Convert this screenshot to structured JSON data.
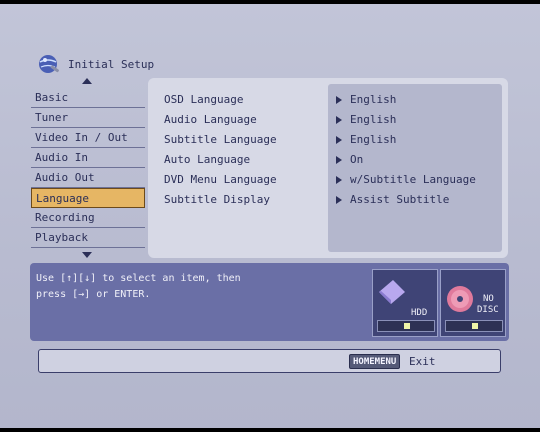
{
  "header": {
    "title": "Initial Setup",
    "icon": "setup-globe-icon"
  },
  "menu": {
    "items": [
      {
        "label": "Basic"
      },
      {
        "label": "Tuner"
      },
      {
        "label": "Video In / Out"
      },
      {
        "label": "Audio In"
      },
      {
        "label": "Audio Out"
      },
      {
        "label": "Language",
        "selected": true
      },
      {
        "label": "Recording"
      },
      {
        "label": "Playback"
      }
    ]
  },
  "settings": {
    "rows": [
      {
        "label": "OSD Language",
        "value": "English"
      },
      {
        "label": "Audio Language",
        "value": "English"
      },
      {
        "label": "Subtitle Language",
        "value": "English"
      },
      {
        "label": "Auto Language",
        "value": "On"
      },
      {
        "label": "DVD Menu Language",
        "value": "w/Subtitle Language"
      },
      {
        "label": "Subtitle Display",
        "value": "Assist Subtitle"
      }
    ]
  },
  "help": {
    "line1": "Use [↑][↓] to select an item, then",
    "line2": "press [→] or ENTER."
  },
  "devices": {
    "hdd_label": "HDD",
    "disc_label_1": "NO",
    "disc_label_2": "DISC"
  },
  "footer": {
    "home_button": "HOMEMENU",
    "exit_label": "Exit"
  },
  "colors": {
    "selected_bg": "#e6b664",
    "help_bg": "#6a6fa6",
    "panel_bg": "#d7d9e6"
  }
}
